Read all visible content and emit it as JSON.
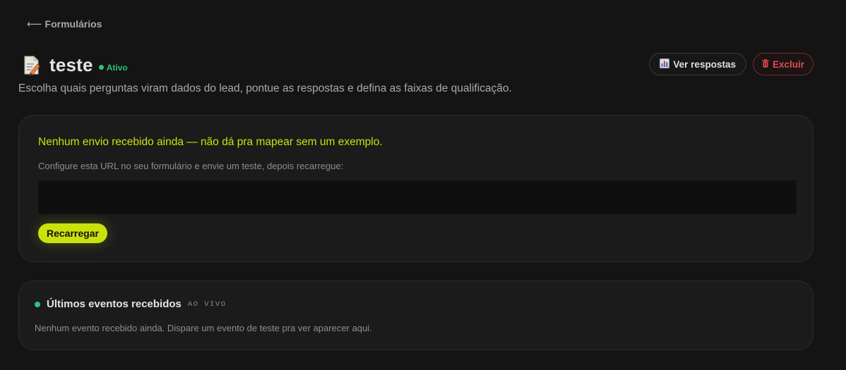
{
  "nav": {
    "back_arrow": "⟵",
    "back_label": "Formulários"
  },
  "form": {
    "icon": "document-edit-icon",
    "title": "teste",
    "status": "Ativo",
    "subtitle": "Escolha quais perguntas viram dados do lead, pontue as respostas e defina as faixas de qualificação."
  },
  "actions": {
    "view_icon": "bar-chart-icon",
    "view_label": "Ver respostas",
    "delete_icon": "trash-icon",
    "delete_label": "Excluir"
  },
  "mapping": {
    "warning": "Nenhum envio recebido ainda — não dá pra mapear sem um exemplo.",
    "hint": "Configure esta URL no seu formulário e envie um teste, depois recarregue:",
    "url_value": "",
    "reload_label": "Recarregar"
  },
  "events": {
    "title": "Últimos eventos recebidos",
    "live_tag": "AO VIVO",
    "empty": "Nenhum evento recebido ainda. Dispare um evento de teste pra ver aparecer aqui."
  },
  "colors": {
    "background": "#141414",
    "card": "#1b1b1b",
    "accent": "#cbe10c",
    "success": "#2ec27e",
    "danger": "#e5484d"
  }
}
